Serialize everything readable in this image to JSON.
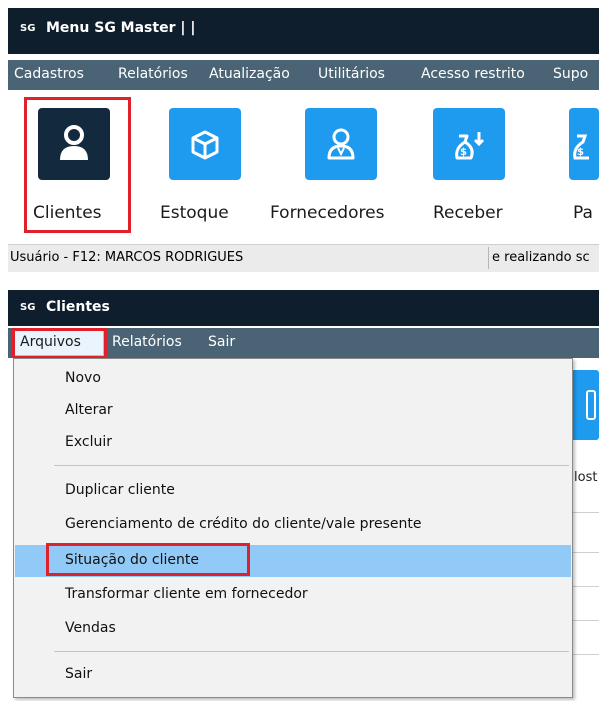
{
  "main_window": {
    "logo": "SG",
    "title": "Menu SG Master | |",
    "menu": [
      "Cadastros",
      "Relatórios",
      "Atualização",
      "Utilitários",
      "Acesso restrito",
      "Supo"
    ],
    "toolbar": [
      {
        "label": "Clientes",
        "icon": "user-icon"
      },
      {
        "label": "Estoque",
        "icon": "box-icon"
      },
      {
        "label": "Fornecedores",
        "icon": "supplier-icon"
      },
      {
        "label": "Receber",
        "icon": "money-bag-icon"
      },
      {
        "label": "Pa",
        "icon": "money-bag-icon"
      }
    ],
    "status": {
      "user": "Usuário - F12: MARCOS RODRIGUES",
      "right": "e realizando sc"
    }
  },
  "clientes_window": {
    "logo": "SG",
    "title": "Clientes",
    "menu": [
      "Arquivos",
      "Relatórios",
      "Sair"
    ],
    "background_partial_text": "lost",
    "dropdown": {
      "items": [
        {
          "label": "Novo"
        },
        {
          "label": "Alterar"
        },
        {
          "label": "Excluir"
        },
        {
          "label": "Duplicar cliente"
        },
        {
          "label": "Gerenciamento de crédito do cliente/vale presente"
        },
        {
          "label": "Situação do cliente"
        },
        {
          "label": "Transformar cliente em fornecedor"
        },
        {
          "label": "Vendas"
        },
        {
          "label": "Sair"
        }
      ],
      "selected": "Situação do cliente"
    }
  },
  "colors": {
    "title_bar": "#0f1e2c",
    "menu_bar": "#4a6475",
    "tool_icon": "#1e9aef",
    "highlight": "#e0202b",
    "selected_item": "#91c9f7"
  }
}
